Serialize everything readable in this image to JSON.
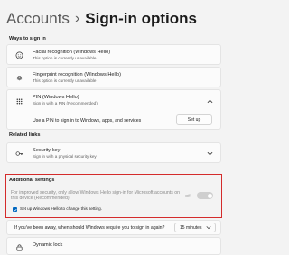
{
  "header": {
    "breadcrumb": "Accounts",
    "separator": "›",
    "title": "Sign-in options"
  },
  "section_ways": "Ways to sign in",
  "face": {
    "title": "Facial recognition (Windows Hello)",
    "subtitle": "This option is currently unavailable"
  },
  "fingerprint": {
    "title": "Fingerprint recognition (Windows Hello)",
    "subtitle": "This option is currently unavailable"
  },
  "pin": {
    "title": "PIN (Windows Hello)",
    "subtitle": "Sign in with a PIN (Recommended)",
    "body": "Use a PIN to sign in to Windows, apps, and services",
    "button": "Set up"
  },
  "related_links": "Related links",
  "security_key": {
    "title": "Security key",
    "subtitle": "Sign in with a physical security key"
  },
  "additional": {
    "title": "Additional settings",
    "text": "For improved security, only allow Windows Hello sign-in for Microsoft accounts on this device (Recommended)",
    "toggle_state": "Off",
    "checkbox_label": "Set up Windows Hello to change this setting."
  },
  "away": {
    "question": "If you've been away, when should Windows require you to sign in again?",
    "value": "15 minutes"
  },
  "dynamic_lock": {
    "title": "Dynamic lock"
  },
  "colors": {
    "accent": "#0067c0",
    "highlight": "#d42b2b"
  }
}
